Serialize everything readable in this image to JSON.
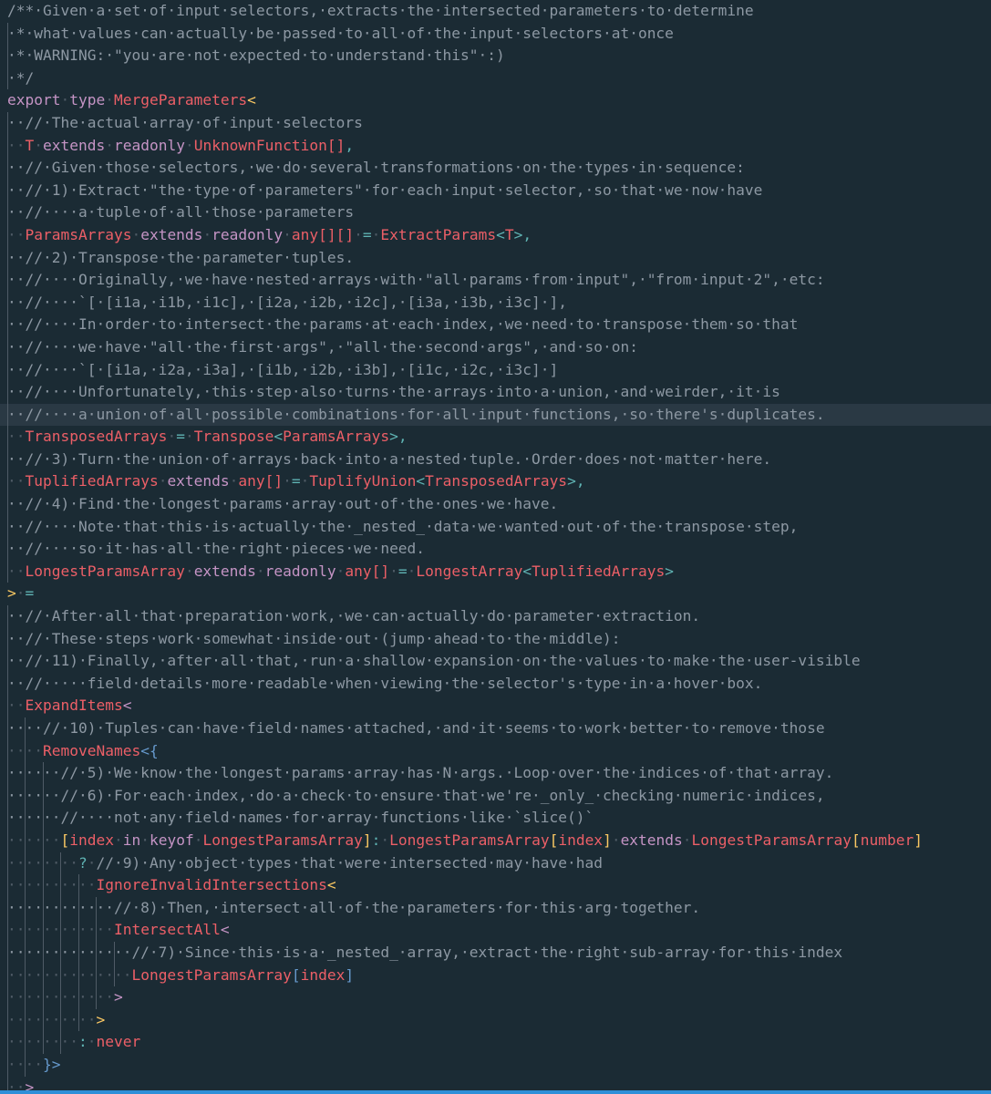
{
  "editor": {
    "language": "TypeScript",
    "colors": {
      "background": "#1b2b34",
      "highlight_line": "#2a3944",
      "comment": "#8d98a3",
      "keyword": "#c594c5",
      "type": "#ec5f67",
      "punct": "#5fb3b3",
      "bracket_gold": "#fac863",
      "bracket_purple": "#c594c5",
      "bracket_blue": "#6699cc",
      "guide": "#4f5b66"
    },
    "highlighted_line": 18,
    "lines": [
      {
        "g": 0,
        "t": [
          [
            "/**·Given·a·set·of·input·selectors,·extracts·the·intersected·parameters·to·determine",
            "c"
          ]
        ]
      },
      {
        "g": 1,
        "t": [
          [
            "·*·what·values·can·actually·be·passed·to·all·of·the·input·selectors·at·once",
            "c"
          ]
        ]
      },
      {
        "g": 1,
        "t": [
          [
            "·*·WARNING:·\"you·are·not·expected·to·understand·this\"·:)",
            "c"
          ]
        ]
      },
      {
        "g": 1,
        "t": [
          [
            "·*/",
            "c"
          ]
        ]
      },
      {
        "g": 0,
        "t": [
          [
            "export",
            "k"
          ],
          [
            "·",
            "d"
          ],
          [
            "type",
            "k"
          ],
          [
            "·",
            "d"
          ],
          [
            "MergeParameters",
            "t"
          ],
          [
            "<",
            "bg"
          ]
        ]
      },
      {
        "g": 1,
        "t": [
          [
            "··//·The·actual·array·of·input·selectors",
            "c"
          ]
        ]
      },
      {
        "g": 1,
        "t": [
          [
            "··",
            "d"
          ],
          [
            "T",
            "t"
          ],
          [
            "·",
            "d"
          ],
          [
            "extends",
            "k"
          ],
          [
            "·",
            "d"
          ],
          [
            "readonly",
            "k"
          ],
          [
            "·",
            "d"
          ],
          [
            "UnknownFunction",
            "t"
          ],
          [
            "[]",
            "t"
          ],
          [
            ",",
            "p"
          ]
        ]
      },
      {
        "g": 1,
        "t": [
          [
            "··//·Given·those·selectors,·we·do·several·transformations·on·the·types·in·sequence:",
            "c"
          ]
        ]
      },
      {
        "g": 1,
        "t": [
          [
            "··//·1)·Extract·\"the·type·of·parameters\"·for·each·input·selector,·so·that·we·now·have",
            "c"
          ]
        ]
      },
      {
        "g": 1,
        "t": [
          [
            "··//····a·tuple·of·all·those·parameters",
            "c"
          ]
        ]
      },
      {
        "g": 1,
        "t": [
          [
            "··",
            "d"
          ],
          [
            "ParamsArrays",
            "t"
          ],
          [
            "·",
            "d"
          ],
          [
            "extends",
            "k"
          ],
          [
            "·",
            "d"
          ],
          [
            "readonly",
            "k"
          ],
          [
            "·",
            "d"
          ],
          [
            "any",
            "t"
          ],
          [
            "[][]",
            "t"
          ],
          [
            "·",
            "d"
          ],
          [
            "=",
            "p"
          ],
          [
            "·",
            "d"
          ],
          [
            "ExtractParams",
            "t"
          ],
          [
            "<",
            "p"
          ],
          [
            "T",
            "t"
          ],
          [
            ">",
            "p"
          ],
          [
            ",",
            "p"
          ]
        ]
      },
      {
        "g": 1,
        "t": [
          [
            "··//·2)·Transpose·the·parameter·tuples.",
            "c"
          ]
        ]
      },
      {
        "g": 1,
        "t": [
          [
            "··//····Originally,·we·have·nested·arrays·with·\"all·params·from·input\",·\"from·input·2\",·etc:",
            "c"
          ]
        ]
      },
      {
        "g": 1,
        "t": [
          [
            "··//····`[·[i1a,·i1b,·i1c],·[i2a,·i2b,·i2c],·[i3a,·i3b,·i3c]·],",
            "c"
          ]
        ]
      },
      {
        "g": 1,
        "t": [
          [
            "··//····In·order·to·intersect·the·params·at·each·index,·we·need·to·transpose·them·so·that",
            "c"
          ]
        ]
      },
      {
        "g": 1,
        "t": [
          [
            "··//····we·have·\"all·the·first·args\",·\"all·the·second·args\",·and·so·on:",
            "c"
          ]
        ]
      },
      {
        "g": 1,
        "t": [
          [
            "··//····`[·[i1a,·i2a,·i3a],·[i1b,·i2b,·i3b],·[i1c,·i2c,·i3c]·]",
            "c"
          ]
        ]
      },
      {
        "g": 1,
        "t": [
          [
            "··//····Unfortunately,·this·step·also·turns·the·arrays·into·a·union,·and·weirder,·it·is",
            "c"
          ]
        ]
      },
      {
        "g": 1,
        "t": [
          [
            "··//····a·union·of·all·possible·combinations·for·all·input·functions,·so·there's·duplicates.",
            "c"
          ]
        ]
      },
      {
        "g": 1,
        "t": [
          [
            "··",
            "d"
          ],
          [
            "TransposedArrays",
            "t"
          ],
          [
            "·",
            "d"
          ],
          [
            "=",
            "p"
          ],
          [
            "·",
            "d"
          ],
          [
            "Transpose",
            "t"
          ],
          [
            "<",
            "p"
          ],
          [
            "ParamsArrays",
            "t"
          ],
          [
            ">",
            "p"
          ],
          [
            ",",
            "p"
          ]
        ]
      },
      {
        "g": 1,
        "t": [
          [
            "··//·3)·Turn·the·union·of·arrays·back·into·a·nested·tuple.·Order·does·not·matter·here.",
            "c"
          ]
        ]
      },
      {
        "g": 1,
        "t": [
          [
            "··",
            "d"
          ],
          [
            "TuplifiedArrays",
            "t"
          ],
          [
            "·",
            "d"
          ],
          [
            "extends",
            "k"
          ],
          [
            "·",
            "d"
          ],
          [
            "any",
            "t"
          ],
          [
            "[]",
            "t"
          ],
          [
            "·",
            "d"
          ],
          [
            "=",
            "p"
          ],
          [
            "·",
            "d"
          ],
          [
            "TuplifyUnion",
            "t"
          ],
          [
            "<",
            "p"
          ],
          [
            "TransposedArrays",
            "t"
          ],
          [
            ">",
            "p"
          ],
          [
            ",",
            "p"
          ]
        ]
      },
      {
        "g": 1,
        "t": [
          [
            "··//·4)·Find·the·longest·params·array·out·of·the·ones·we·have.",
            "c"
          ]
        ]
      },
      {
        "g": 1,
        "t": [
          [
            "··//····Note·that·this·is·actually·the·_nested_·data·we·wanted·out·of·the·transpose·step,",
            "c"
          ]
        ]
      },
      {
        "g": 1,
        "t": [
          [
            "··//····so·it·has·all·the·right·pieces·we·need.",
            "c"
          ]
        ]
      },
      {
        "g": 1,
        "t": [
          [
            "··",
            "d"
          ],
          [
            "LongestParamsArray",
            "t"
          ],
          [
            "·",
            "d"
          ],
          [
            "extends",
            "k"
          ],
          [
            "·",
            "d"
          ],
          [
            "readonly",
            "k"
          ],
          [
            "·",
            "d"
          ],
          [
            "any",
            "t"
          ],
          [
            "[]",
            "t"
          ],
          [
            "·",
            "d"
          ],
          [
            "=",
            "p"
          ],
          [
            "·",
            "d"
          ],
          [
            "LongestArray",
            "t"
          ],
          [
            "<",
            "p"
          ],
          [
            "TuplifiedArrays",
            "t"
          ],
          [
            ">",
            "p"
          ]
        ]
      },
      {
        "g": 0,
        "t": [
          [
            ">",
            "bg"
          ],
          [
            "·",
            "d"
          ],
          [
            "=",
            "p"
          ]
        ]
      },
      {
        "g": 1,
        "t": [
          [
            "··//·After·all·that·preparation·work,·we·can·actually·do·parameter·extraction.",
            "c"
          ]
        ]
      },
      {
        "g": 1,
        "t": [
          [
            "··//·These·steps·work·somewhat·inside·out·(jump·ahead·to·the·middle):",
            "c"
          ]
        ]
      },
      {
        "g": 1,
        "t": [
          [
            "··//·11)·Finally,·after·all·that,·run·a·shallow·expansion·on·the·values·to·make·the·user-visible",
            "c"
          ]
        ]
      },
      {
        "g": 1,
        "t": [
          [
            "··//·····field·details·more·readable·when·viewing·the·selector's·type·in·a·hover·box.",
            "c"
          ]
        ]
      },
      {
        "g": 1,
        "t": [
          [
            "··",
            "d"
          ],
          [
            "ExpandItems",
            "t"
          ],
          [
            "<",
            "bp"
          ]
        ]
      },
      {
        "g": 2,
        "t": [
          [
            "····//·10)·Tuples·can·have·field·names·attached,·and·it·seems·to·work·better·to·remove·those",
            "c"
          ]
        ]
      },
      {
        "g": 2,
        "t": [
          [
            "····",
            "d"
          ],
          [
            "RemoveNames",
            "t"
          ],
          [
            "<",
            "bb"
          ],
          [
            "{",
            "bb"
          ]
        ]
      },
      {
        "g": 3,
        "t": [
          [
            "······//·5)·We·know·the·longest·params·array·has·N·args.·Loop·over·the·indices·of·that·array.",
            "c"
          ]
        ]
      },
      {
        "g": 3,
        "t": [
          [
            "······//·6)·For·each·index,·do·a·check·to·ensure·that·we're·_only_·checking·numeric·indices,",
            "c"
          ]
        ]
      },
      {
        "g": 3,
        "t": [
          [
            "······//····not·any·field·names·for·array·functions·like·`slice()`",
            "c"
          ]
        ]
      },
      {
        "g": 3,
        "t": [
          [
            "······",
            "d"
          ],
          [
            "[",
            "bg"
          ],
          [
            "index",
            "t"
          ],
          [
            "·",
            "d"
          ],
          [
            "in",
            "k"
          ],
          [
            "·",
            "d"
          ],
          [
            "keyof",
            "k"
          ],
          [
            "·",
            "d"
          ],
          [
            "LongestParamsArray",
            "t"
          ],
          [
            "]",
            "bg"
          ],
          [
            ":",
            "p"
          ],
          [
            "·",
            "d"
          ],
          [
            "LongestParamsArray",
            "t"
          ],
          [
            "[",
            "bg"
          ],
          [
            "index",
            "t"
          ],
          [
            "]",
            "bg"
          ],
          [
            "·",
            "d"
          ],
          [
            "extends",
            "k"
          ],
          [
            "·",
            "d"
          ],
          [
            "LongestParamsArray",
            "t"
          ],
          [
            "[",
            "bg"
          ],
          [
            "number",
            "t"
          ],
          [
            "]",
            "bg"
          ]
        ]
      },
      {
        "g": 4,
        "t": [
          [
            "········",
            "d"
          ],
          [
            "?",
            "p"
          ],
          [
            "·",
            "d"
          ],
          [
            "//·9)·Any·object·types·that·were·intersected·may·have·had",
            "c"
          ]
        ]
      },
      {
        "g": 5,
        "t": [
          [
            "··········",
            "d"
          ],
          [
            "IgnoreInvalidIntersections",
            "t"
          ],
          [
            "<",
            "bg"
          ]
        ]
      },
      {
        "g": 6,
        "t": [
          [
            "············//·8)·Then,·intersect·all·of·the·parameters·for·this·arg·together.",
            "c"
          ]
        ]
      },
      {
        "g": 6,
        "t": [
          [
            "············",
            "d"
          ],
          [
            "IntersectAll",
            "t"
          ],
          [
            "<",
            "bp"
          ]
        ]
      },
      {
        "g": 7,
        "t": [
          [
            "··············//·7)·Since·this·is·a·_nested_·array,·extract·the·right·sub-array·for·this·index",
            "c"
          ]
        ]
      },
      {
        "g": 7,
        "t": [
          [
            "··············",
            "d"
          ],
          [
            "LongestParamsArray",
            "t"
          ],
          [
            "[",
            "bb"
          ],
          [
            "index",
            "t"
          ],
          [
            "]",
            "bb"
          ]
        ]
      },
      {
        "g": 6,
        "t": [
          [
            "············",
            "d"
          ],
          [
            ">",
            "bp"
          ]
        ]
      },
      {
        "g": 5,
        "t": [
          [
            "··········",
            "d"
          ],
          [
            ">",
            "bg"
          ]
        ]
      },
      {
        "g": 4,
        "t": [
          [
            "········",
            "d"
          ],
          [
            ":",
            "p"
          ],
          [
            "·",
            "d"
          ],
          [
            "never",
            "t"
          ]
        ]
      },
      {
        "g": 2,
        "t": [
          [
            "····",
            "d"
          ],
          [
            "}>",
            "bb"
          ]
        ]
      },
      {
        "g": 1,
        "t": [
          [
            "··",
            "d"
          ],
          [
            ">",
            "bp"
          ]
        ]
      }
    ]
  }
}
